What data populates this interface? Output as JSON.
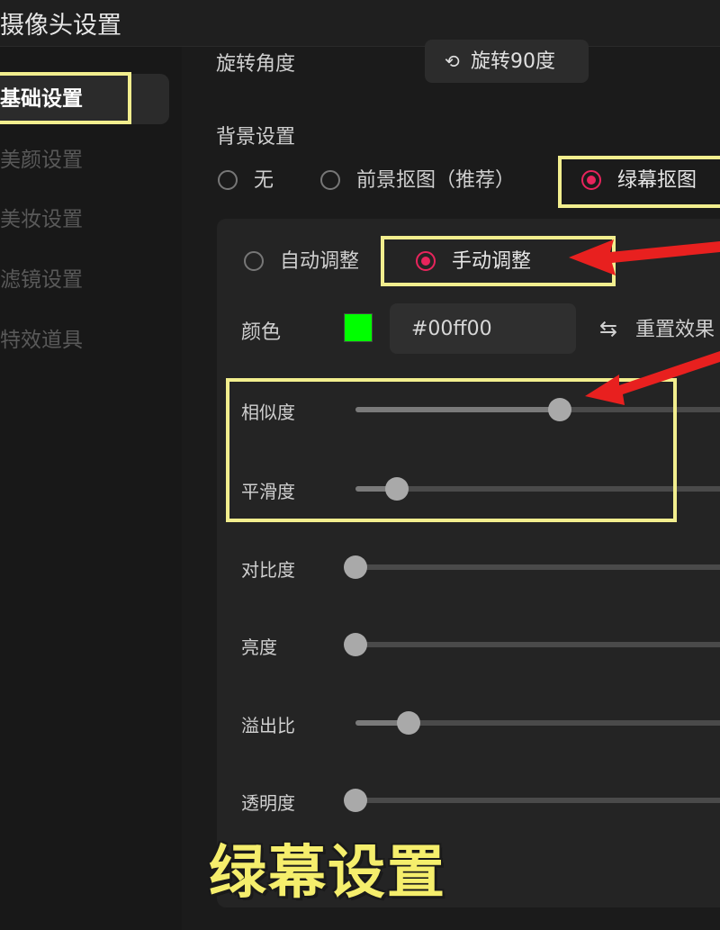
{
  "window": {
    "title": "摄像头设置"
  },
  "sidebar": {
    "items": [
      {
        "label": "基础设置",
        "active": true
      },
      {
        "label": "美颜设置"
      },
      {
        "label": "美妆设置"
      },
      {
        "label": "滤镜设置"
      },
      {
        "label": "特效道具"
      }
    ]
  },
  "rotation": {
    "label": "旋转角度",
    "button_label": "旋转90度",
    "button_icon": "rotate-icon"
  },
  "background": {
    "label": "背景设置",
    "options": [
      {
        "label": "无",
        "selected": false
      },
      {
        "label": "前景抠图（推荐）",
        "selected": false
      },
      {
        "label": "绿幕抠图",
        "selected": true
      }
    ]
  },
  "mode": {
    "options": [
      {
        "label": "自动调整",
        "selected": false
      },
      {
        "label": "手动调整",
        "selected": true
      }
    ]
  },
  "color": {
    "label": "颜色",
    "value": "#00ff00",
    "swatch": "#00ff00",
    "reset_label": "重置效果",
    "reset_icon": "swap-arrows-icon"
  },
  "sliders": [
    {
      "label": "相似度",
      "value": 0.54
    },
    {
      "label": "平滑度",
      "value": 0.11
    },
    {
      "label": "对比度",
      "value": 0.0
    },
    {
      "label": "亮度",
      "value": 0.0
    },
    {
      "label": "溢出比",
      "value": 0.14
    },
    {
      "label": "透明度",
      "value": 0.0
    }
  ],
  "overlay": {
    "caption": "绿幕设置",
    "highlight_color": "#f2ee8e",
    "arrow_color": "#e8201f"
  }
}
